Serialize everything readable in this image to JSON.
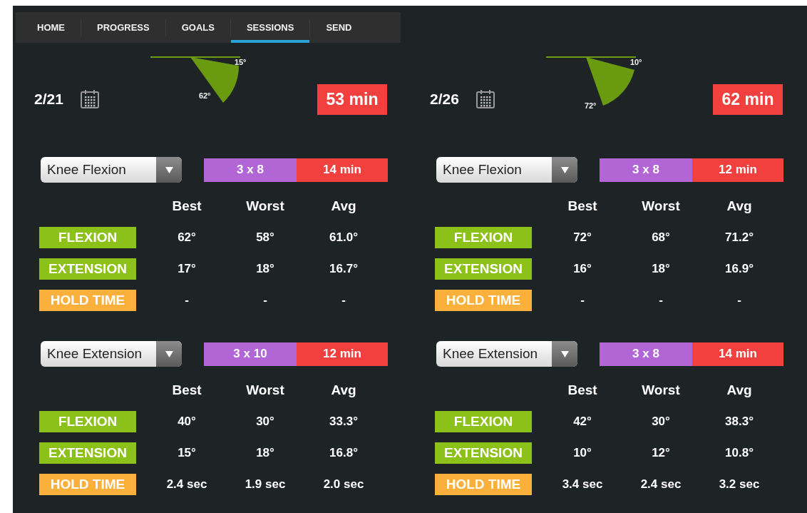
{
  "tabs": [
    {
      "label": "HOME",
      "selected": false
    },
    {
      "label": "PROGRESS",
      "selected": false
    },
    {
      "label": "GOALS",
      "selected": false
    },
    {
      "label": "SESSIONS",
      "selected": true
    },
    {
      "label": "SEND",
      "selected": false
    }
  ],
  "sessions": [
    {
      "date": "2/21",
      "angle_small": "15°",
      "angle_large": "62°",
      "duration": "53 min",
      "exercises": [
        {
          "name": "Knee Flexion",
          "sets": "3 x 8",
          "duration": "14 min",
          "headers": [
            "Best",
            "Worst",
            "Avg"
          ],
          "rows": [
            {
              "label": "FLEXION",
              "color": "#8cc11a",
              "values": [
                "62°",
                "58°",
                "61.0°"
              ]
            },
            {
              "label": "EXTENSION",
              "color": "#8cc11a",
              "values": [
                "17°",
                "18°",
                "16.7°"
              ]
            },
            {
              "label": "HOLD TIME",
              "color": "#fbb03b",
              "values": [
                "-",
                "-",
                "-"
              ]
            }
          ]
        },
        {
          "name": "Knee Extension",
          "sets": "3 x 10",
          "duration": "12 min",
          "headers": [
            "Best",
            "Worst",
            "Avg"
          ],
          "rows": [
            {
              "label": "FLEXION",
              "color": "#8cc11a",
              "values": [
                "40°",
                "30°",
                "33.3°"
              ]
            },
            {
              "label": "EXTENSION",
              "color": "#8cc11a",
              "values": [
                "15°",
                "18°",
                "16.8°"
              ]
            },
            {
              "label": "HOLD TIME",
              "color": "#fbb03b",
              "values": [
                "2.4 sec",
                "1.9 sec",
                "2.0 sec"
              ]
            }
          ]
        }
      ]
    },
    {
      "date": "2/26",
      "angle_small": "10°",
      "angle_large": "72°",
      "duration": "62 min",
      "exercises": [
        {
          "name": "Knee Flexion",
          "sets": "3 x 8",
          "duration": "12 min",
          "headers": [
            "Best",
            "Worst",
            "Avg"
          ],
          "rows": [
            {
              "label": "FLEXION",
              "color": "#8cc11a",
              "values": [
                "72°",
                "68°",
                "71.2°"
              ]
            },
            {
              "label": "EXTENSION",
              "color": "#8cc11a",
              "values": [
                "16°",
                "18°",
                "16.9°"
              ]
            },
            {
              "label": "HOLD TIME",
              "color": "#fbb03b",
              "values": [
                "-",
                "-",
                "-"
              ]
            }
          ]
        },
        {
          "name": "Knee Extension",
          "sets": "3 x 8",
          "duration": "14 min",
          "headers": [
            "Best",
            "Worst",
            "Avg"
          ],
          "rows": [
            {
              "label": "FLEXION",
              "color": "#8cc11a",
              "values": [
                "42°",
                "30°",
                "38.3°"
              ]
            },
            {
              "label": "EXTENSION",
              "color": "#8cc11a",
              "values": [
                "10°",
                "12°",
                "10.8°"
              ]
            },
            {
              "label": "HOLD TIME",
              "color": "#fbb03b",
              "values": [
                "3.4 sec",
                "2.4 sec",
                "3.2 sec"
              ]
            }
          ]
        }
      ]
    }
  ]
}
